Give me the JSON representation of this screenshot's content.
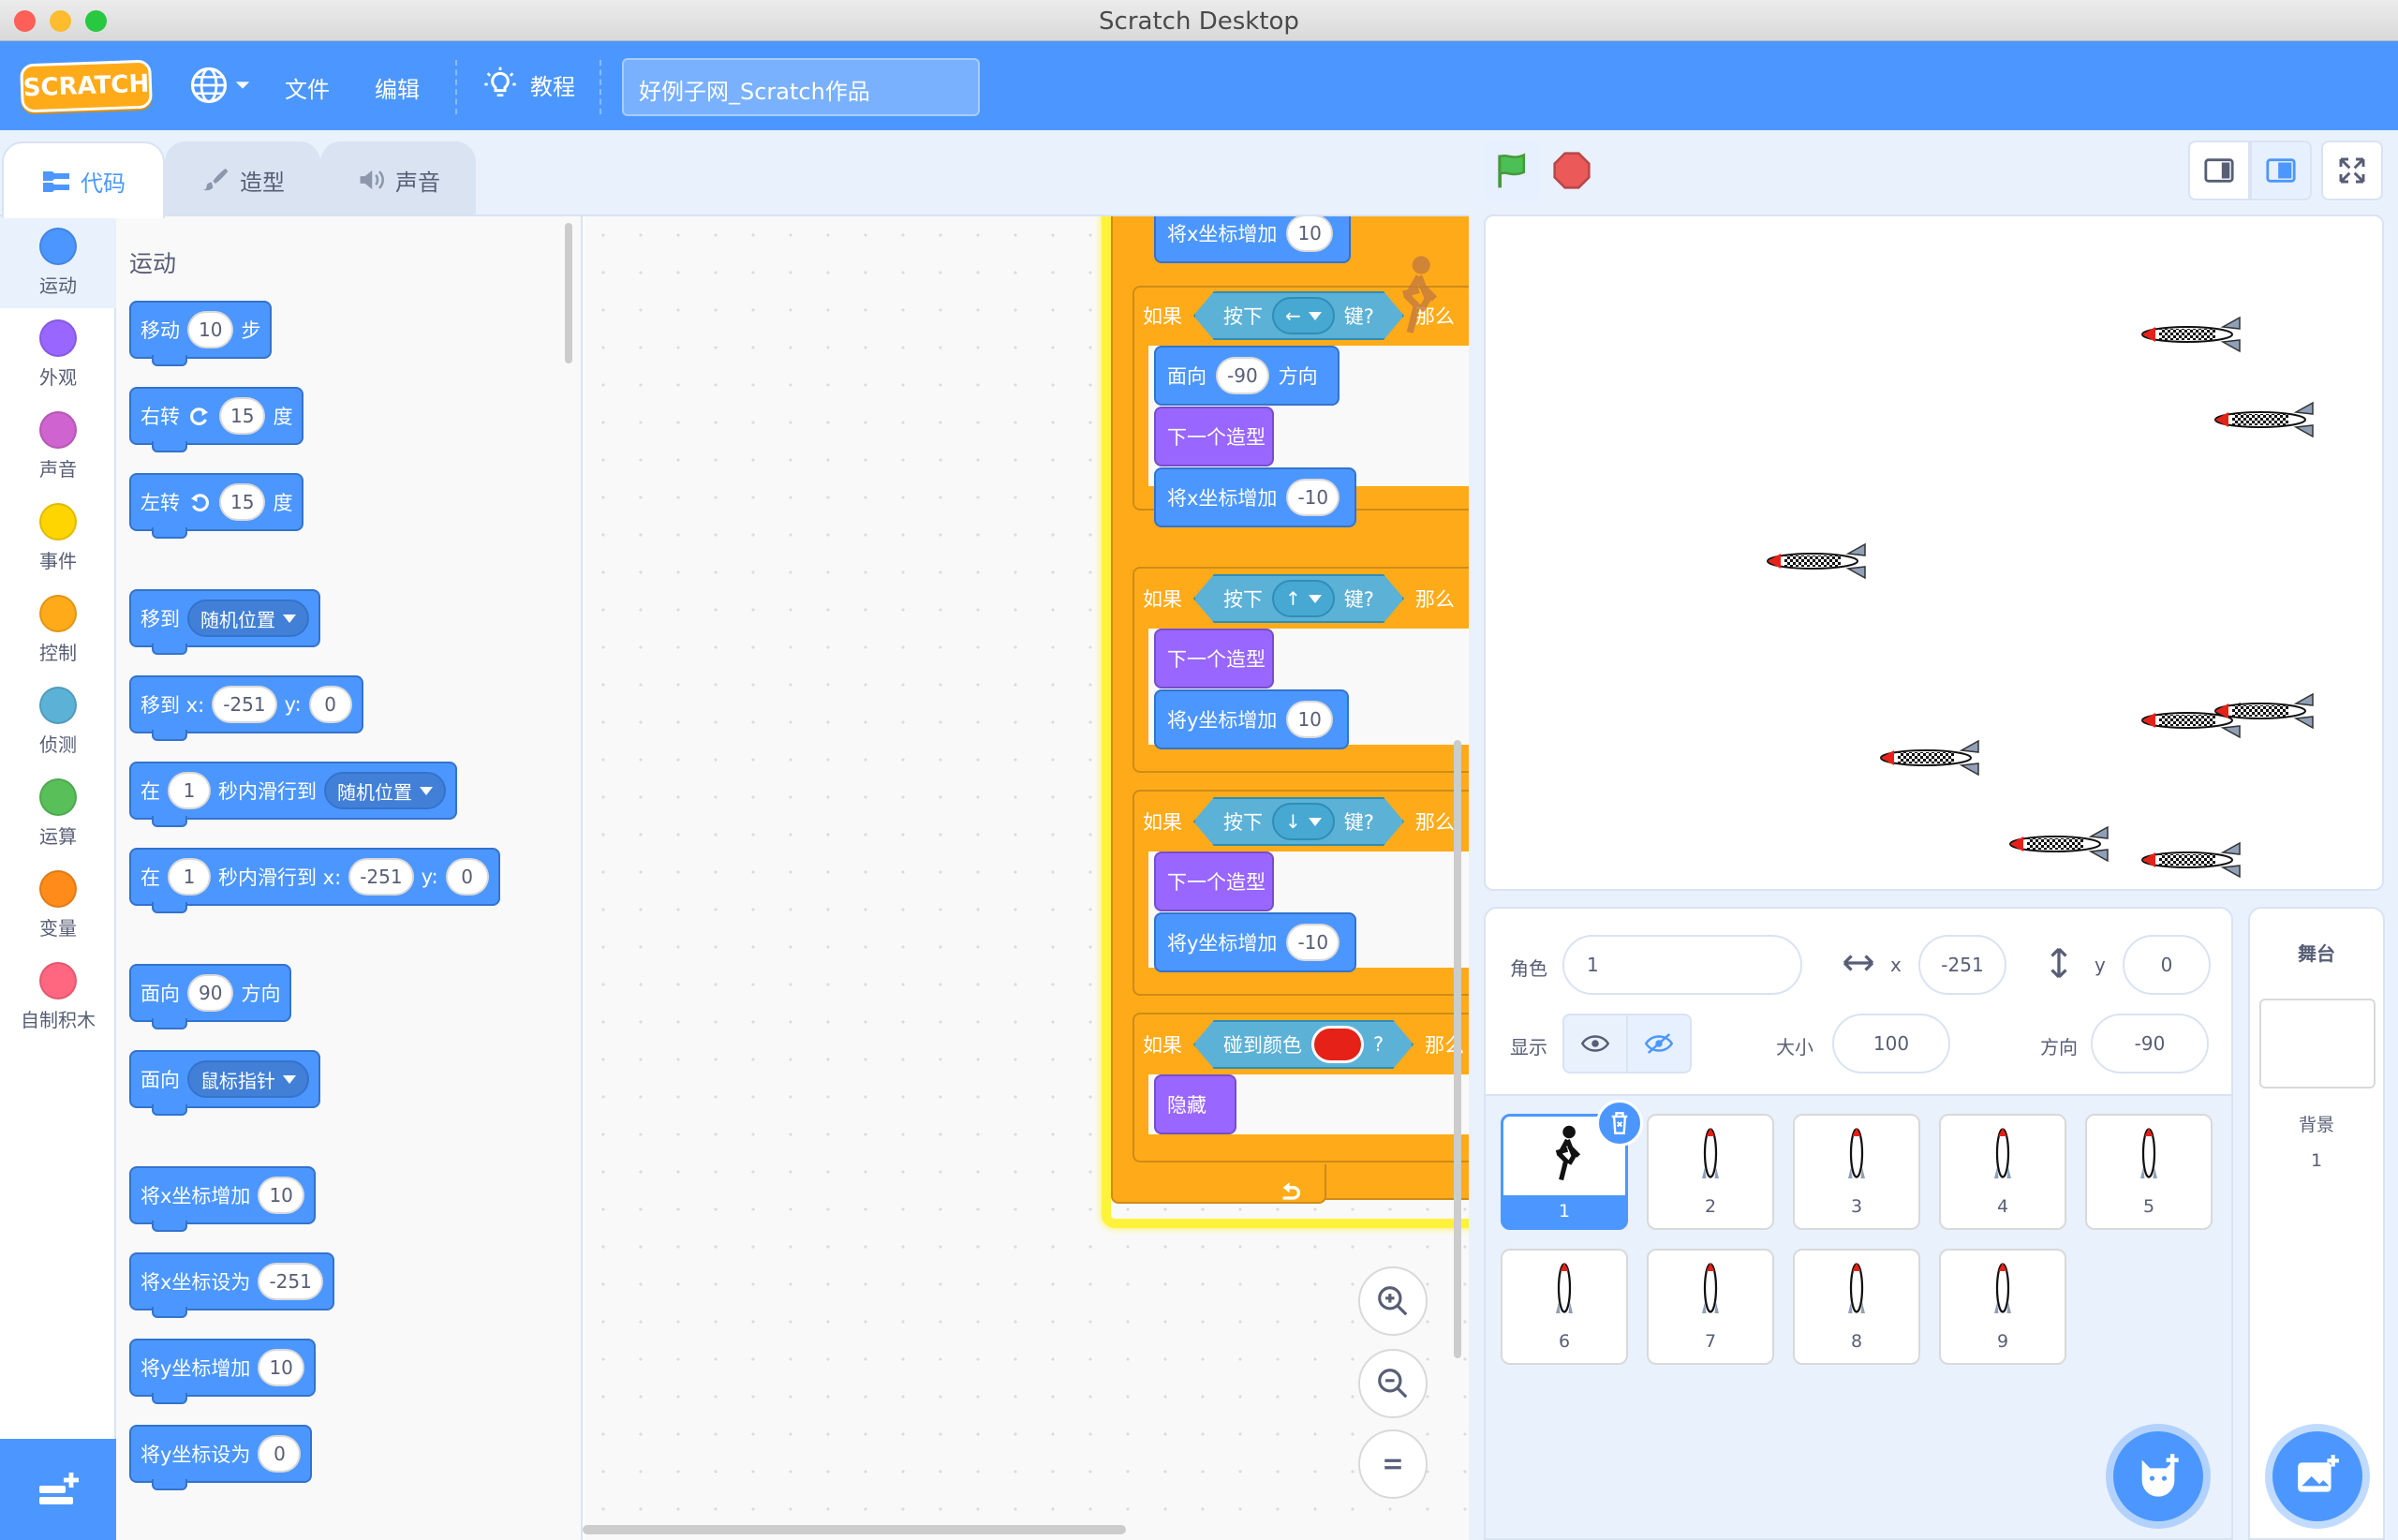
{
  "window": {
    "title": "Scratch Desktop"
  },
  "menu": {
    "logo": "SCRATCH",
    "file": "文件",
    "edit": "编辑",
    "tutorials": "教程",
    "project_title": "好例子网_Scratch作品"
  },
  "tabs": {
    "code": "代码",
    "costumes": "造型",
    "sounds": "声音"
  },
  "categories": [
    {
      "label": "运动",
      "color": "#4c97ff"
    },
    {
      "label": "外观",
      "color": "#9966ff"
    },
    {
      "label": "声音",
      "color": "#cf63cf"
    },
    {
      "label": "事件",
      "color": "#ffd500"
    },
    {
      "label": "控制",
      "color": "#ffab19"
    },
    {
      "label": "侦测",
      "color": "#5cb1d6"
    },
    {
      "label": "运算",
      "color": "#59c059"
    },
    {
      "label": "变量",
      "color": "#ff8c1a"
    },
    {
      "label": "自制积木",
      "color": "#ff6680"
    }
  ],
  "palette": {
    "heading": "运动",
    "move": {
      "a": "移动",
      "v": "10",
      "b": "步"
    },
    "turn_right": {
      "a": "右转",
      "v": "15",
      "b": "度"
    },
    "turn_left": {
      "a": "左转",
      "v": "15",
      "b": "度"
    },
    "goto": {
      "a": "移到",
      "menu": "随机位置"
    },
    "goto_xy": {
      "a": "移到 x:",
      "x": "-251",
      "ylab": "y:",
      "y": "0"
    },
    "glide": {
      "a": "在",
      "v": "1",
      "b": "秒内滑行到",
      "menu": "随机位置"
    },
    "glide_xy": {
      "a": "在",
      "v": "1",
      "b": "秒内滑行到 x:",
      "x": "-251",
      "ylab": "y:",
      "y": "0"
    },
    "point_dir": {
      "a": "面向",
      "v": "90",
      "b": "方向"
    },
    "point_towards": {
      "a": "面向",
      "menu": "鼠标指针"
    },
    "change_x": {
      "a": "将x坐标增加",
      "v": "10"
    },
    "set_x": {
      "a": "将x坐标设为",
      "v": "-251"
    },
    "change_y": {
      "a": "将y坐标增加",
      "v": "10"
    },
    "set_y": {
      "a": "将y坐标设为",
      "v": "0"
    }
  },
  "script": {
    "top": {
      "a": "将x坐标增加",
      "v": "10"
    },
    "if_left": {
      "if": "如果",
      "key_a": "按下",
      "key": "←",
      "key_b": "键?",
      "then": "那么"
    },
    "face": {
      "a": "面向",
      "v": "-90",
      "b": "方向"
    },
    "next1": "下一个造型",
    "chx": {
      "a": "将x坐标增加",
      "v": "-10"
    },
    "if_up": {
      "if": "如果",
      "key_a": "按下",
      "key": "↑",
      "key_b": "键?",
      "then": "那么"
    },
    "next2": "下一个造型",
    "chy_up": {
      "a": "将y坐标增加",
      "v": "10"
    },
    "if_down": {
      "if": "如果",
      "key_a": "按下",
      "key": "↓",
      "key_b": "键?",
      "then": "那么"
    },
    "next3": "下一个造型",
    "chy_down": {
      "a": "将y坐标增加",
      "v": "-10"
    },
    "if_color": {
      "if": "如果",
      "a": "碰到颜色",
      "q": "?",
      "then": "那么",
      "color": "#e62117"
    },
    "hide": "隐藏"
  },
  "sprite_info": {
    "sprite_label": "角色",
    "sprite_name": "1",
    "x_label": "x",
    "x": "-251",
    "y_label": "y",
    "y": "0",
    "show_label": "显示",
    "size_label": "大小",
    "size": "100",
    "direction_label": "方向",
    "direction": "-90"
  },
  "sprites": [
    "1",
    "2",
    "3",
    "4",
    "5",
    "6",
    "7",
    "8",
    "9"
  ],
  "stage_panel": {
    "title": "舞台",
    "backdrops_label": "背景",
    "backdrops_count": "1"
  }
}
